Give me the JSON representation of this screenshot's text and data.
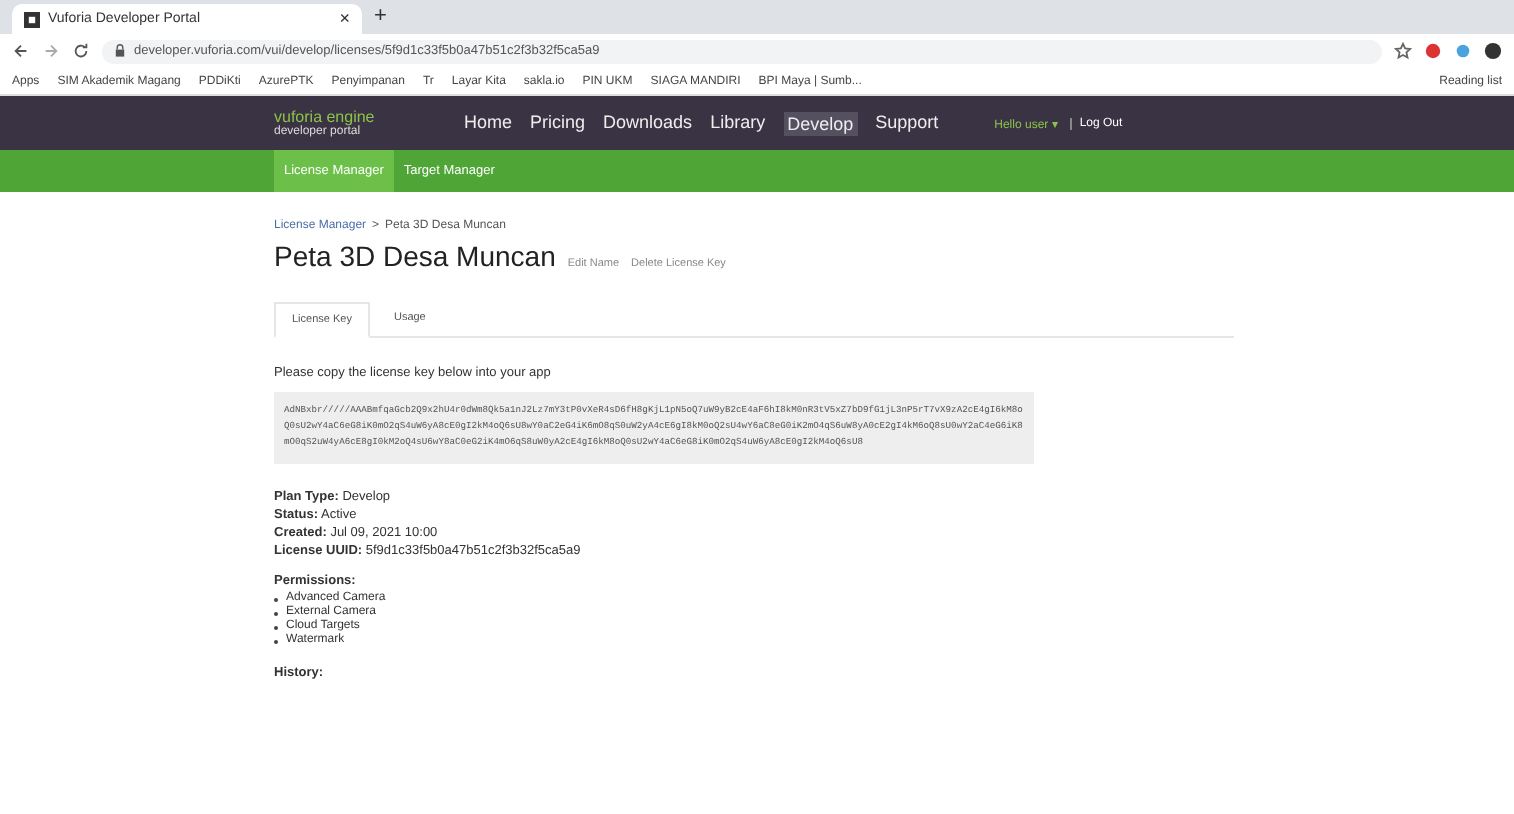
{
  "browser": {
    "tab_title": "Vuforia Developer Portal",
    "tab_close": "×",
    "new_tab": "+",
    "url": "developer.vuforia.com/vui/develop/licenses/5f9d1c33f5b0a47b51c2f3b32f5ca5a9",
    "bookmarks": [
      {
        "label": "Apps"
      },
      {
        "label": "SIM Akademik Magang"
      },
      {
        "label": "PDDiKti"
      },
      {
        "label": "AzurePTK"
      },
      {
        "label": "Penyimpanan"
      },
      {
        "label": "Tr"
      },
      {
        "label": "Layar Kita"
      },
      {
        "label": "sakla.io"
      },
      {
        "label": "PIN UKM"
      },
      {
        "label": "SIAGA MANDIRI"
      },
      {
        "label": "BPI Maya | Sumb..."
      }
    ],
    "reading_list": "Reading list"
  },
  "header": {
    "logo_top": "vuforia engine",
    "logo_bottom": "developer portal",
    "nav": [
      {
        "label": "Home",
        "selected": false
      },
      {
        "label": "Pricing",
        "selected": false
      },
      {
        "label": "Downloads",
        "selected": false
      },
      {
        "label": "Library",
        "selected": false
      },
      {
        "label": "Develop",
        "selected": true
      },
      {
        "label": "Support",
        "selected": false
      }
    ],
    "user": "Hello user ▾",
    "logout": "Log Out"
  },
  "subnav": [
    {
      "label": "License Manager",
      "selected": true
    },
    {
      "label": "Target Manager",
      "selected": false
    }
  ],
  "breadcrumb": {
    "parent": "License Manager",
    "separator": ">",
    "current": "Peta 3D Desa Muncan"
  },
  "title": "Peta 3D Desa Muncan",
  "title_actions": [
    "Edit Name",
    "Delete License Key"
  ],
  "tabs": [
    {
      "label": "License Key",
      "selected": true
    },
    {
      "label": "Usage",
      "selected": false
    }
  ],
  "instruction": "Please copy the license key below into your app",
  "license_key": "AdNBxbr/////AAABmfqaGcb2Q9x2hU4r0dWm8Qk5a1nJ2Lz7mY3tP0vXeR4sD6fH8gKjL1pN5oQ7uW9yB2cE4aF6hI8kM0nR3tV5xZ7bD9fG1jL3nP5rT7vX9zA2cE4gI6kM8oQ0sU2wY4aC6eG8iK0mO2qS4uW6yA8cE0gI2kM4oQ6sU8wY0aC2eG4iK6mO8qS0uW2yA4cE6gI8kM0oQ2sU4wY6aC8eG0iK2mO4qS6uW8yA0cE2gI4kM6oQ8sU0wY2aC4eG6iK8mO0qS2uW4yA6cE8gI0kM2oQ4sU6wY8aC0eG2iK4mO6qS8uW0yA2cE4gI6kM8oQ0sU2wY4aC6eG8iK0mO2qS4uW6yA8cE0gI2kM4oQ6sU8",
  "details": [
    {
      "label": "Plan Type:",
      "value": "Develop"
    },
    {
      "label": "Status:",
      "value": "Active"
    },
    {
      "label": "Created:",
      "value": "Jul 09, 2021 10:00"
    },
    {
      "label": "License UUID:",
      "value": "5f9d1c33f5b0a47b51c2f3b32f5ca5a9"
    }
  ],
  "permissions_label": "Permissions:",
  "permissions": [
    "Advanced Camera",
    "External Camera",
    "Cloud Targets",
    "Watermark"
  ],
  "history_label": "History:"
}
